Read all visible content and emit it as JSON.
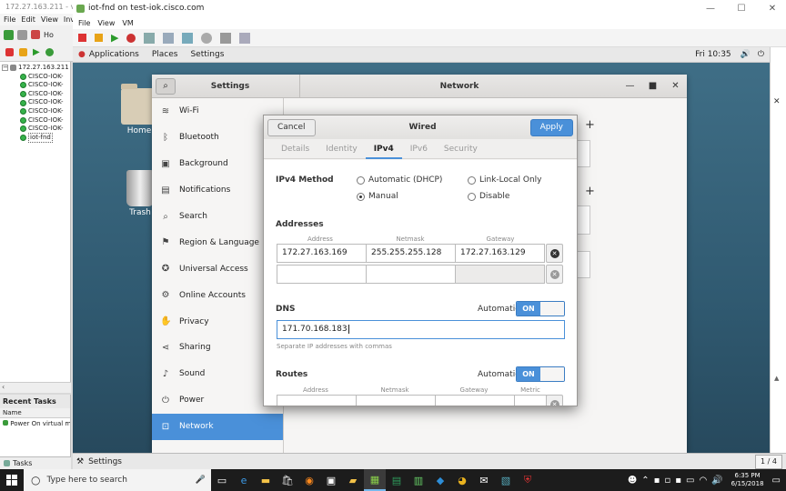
{
  "outer": {
    "title": "172.27.163.211 - vS",
    "menu": [
      "File",
      "Edit",
      "View",
      "Inve"
    ],
    "home_tab": "Ho",
    "tree": [
      {
        "label": "172.27.163.211",
        "type": "host"
      },
      {
        "label": "CISCO-IOK-",
        "type": "vm"
      },
      {
        "label": "CISCO-IOK-",
        "type": "vm"
      },
      {
        "label": "CISCO-IOK-",
        "type": "vm"
      },
      {
        "label": "CISCO-IOK-",
        "type": "vm"
      },
      {
        "label": "CISCO-IOK-",
        "type": "vm"
      },
      {
        "label": "CISCO-IOK-",
        "type": "vm"
      },
      {
        "label": "CISCO-IOK-",
        "type": "vm"
      },
      {
        "label": "iot-fnd",
        "type": "vm"
      }
    ],
    "recent_tasks_title": "Recent Tasks",
    "recent_tasks_col": "Name",
    "recent_tasks_row": "Power On virtual m",
    "tasks_tab": "Tasks"
  },
  "console": {
    "title": "iot-fnd on test-iok.cisco.com",
    "menu": [
      "File",
      "View",
      "VM"
    ]
  },
  "gnome": {
    "topbar": {
      "applications": "Applications",
      "places": "Places",
      "settings": "Settings",
      "clock": "Fri 10:35"
    },
    "desktop": {
      "home_label": "Home",
      "trash_label": "Trash"
    },
    "taskbar": {
      "settings_label": "Settings",
      "workspace": "1 / 4"
    }
  },
  "settings": {
    "title": "Settings",
    "network_title": "Network",
    "sidebar": [
      {
        "label": "Wi-Fi",
        "icon": "wifi-icon",
        "glyph": "≋"
      },
      {
        "label": "Bluetooth",
        "icon": "bluetooth-icon",
        "glyph": "ᛒ"
      },
      {
        "label": "Background",
        "icon": "background-icon",
        "glyph": "▣"
      },
      {
        "label": "Notifications",
        "icon": "notifications-icon",
        "glyph": "▤"
      },
      {
        "label": "Search",
        "icon": "search-icon",
        "glyph": "⌕"
      },
      {
        "label": "Region & Language",
        "icon": "region-icon",
        "glyph": "⚑"
      },
      {
        "label": "Universal Access",
        "icon": "accessibility-icon",
        "glyph": "✪"
      },
      {
        "label": "Online Accounts",
        "icon": "online-accounts-icon",
        "glyph": "⚙"
      },
      {
        "label": "Privacy",
        "icon": "privacy-icon",
        "glyph": "✋"
      },
      {
        "label": "Sharing",
        "icon": "sharing-icon",
        "glyph": "⋖"
      },
      {
        "label": "Sound",
        "icon": "sound-icon",
        "glyph": "♪"
      },
      {
        "label": "Power",
        "icon": "power-icon",
        "glyph": "⏻"
      },
      {
        "label": "Network",
        "icon": "network-icon",
        "glyph": "⊡"
      }
    ]
  },
  "wired": {
    "title": "Wired",
    "cancel": "Cancel",
    "apply": "Apply",
    "tabs": [
      "Details",
      "Identity",
      "IPv4",
      "IPv6",
      "Security"
    ],
    "ipv4_method_label": "IPv4 Method",
    "methods": {
      "automatic": "Automatic (DHCP)",
      "link_local": "Link-Local Only",
      "manual": "Manual",
      "disable": "Disable"
    },
    "addresses_label": "Addresses",
    "address_cols": [
      "Address",
      "Netmask",
      "Gateway"
    ],
    "address_rows": [
      {
        "address": "172.27.163.169",
        "netmask": "255.255.255.128",
        "gateway": "172.27.163.129"
      },
      {
        "address": "",
        "netmask": "",
        "gateway": ""
      }
    ],
    "dns_label": "DNS",
    "automatic_label": "Automatic",
    "switch_on": "ON",
    "dns_value": "171.70.168.183",
    "dns_hint": "Separate IP addresses with commas",
    "routes_label": "Routes",
    "route_cols": [
      "Address",
      "Netmask",
      "Gateway",
      "Metric"
    ]
  },
  "windows": {
    "search_placeholder": "Type here to search",
    "clock_time": "6:35 PM",
    "clock_date": "6/15/2018"
  }
}
